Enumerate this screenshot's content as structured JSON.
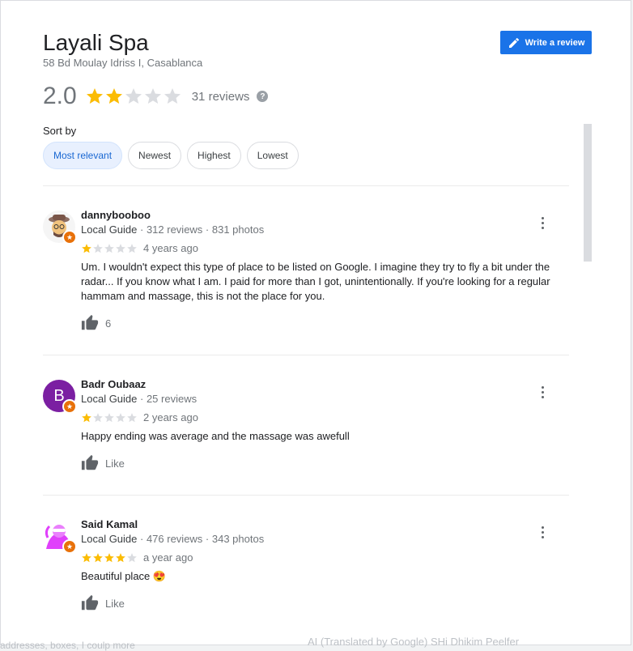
{
  "place": {
    "name": "Layali Spa",
    "address": "58 Bd Moulay Idriss I, Casablanca",
    "rating": "2.0",
    "rating_value": 2,
    "review_count": "31 reviews",
    "help_glyph": "?"
  },
  "write_review": {
    "label": "Write a review",
    "icon": "pencil-icon"
  },
  "sort": {
    "label": "Sort by",
    "options": [
      "Most relevant",
      "Newest",
      "Highest",
      "Lowest"
    ],
    "active": "Most relevant"
  },
  "reviews": [
    {
      "name": "dannybooboo",
      "guide": "Local Guide",
      "stats": " · 312 reviews · 831 photos",
      "stars": 1,
      "date": "4 years ago",
      "text": "Um. I wouldn't expect this type of place to be listed on Google. I imagine they try to fly a bit under the radar... If you know what I am. I paid for more than I got, unintentionally. If you're looking for a regular hammam and massage, this is not the place for you.",
      "likes": "6",
      "avatar_letter": "",
      "avatar_color": "#f5f5f5"
    },
    {
      "name": "Badr Oubaaz",
      "guide": "Local Guide",
      "stats": " · 25 reviews",
      "stars": 1,
      "date": "2 years ago",
      "text": "Happy ending was average and the massage was awefull",
      "likes": "Like",
      "avatar_letter": "B",
      "avatar_color": "#7b1fa2"
    },
    {
      "name": "Said Kamal",
      "guide": "Local Guide",
      "stats": " · 476 reviews · 343 photos",
      "stars": 4,
      "date": "a year ago",
      "text": "Beautiful place 😍",
      "likes": "Like",
      "avatar_letter": "",
      "avatar_color": "#e040fb"
    }
  ],
  "peek": {
    "left": "addresses, boxes, I coulp more",
    "right": "AI (Translated by Google) SHi Dhikim Peelfer"
  },
  "colors": {
    "star_filled": "#fbbc04",
    "star_empty": "#dadce0",
    "accent": "#1a73e8"
  }
}
